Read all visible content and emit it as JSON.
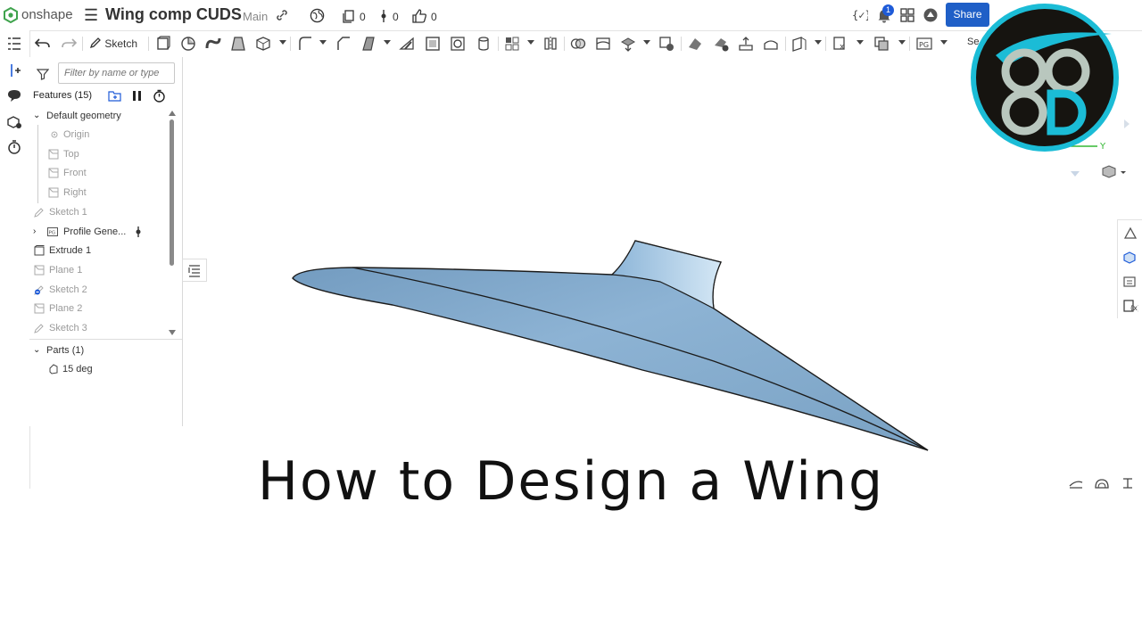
{
  "app": {
    "brand": "onshape",
    "document_title": "Wing comp CUDS",
    "branch": "Main",
    "counters": {
      "versions": "0",
      "branches": "0",
      "likes": "0"
    },
    "notification_count": "1",
    "share_label": "Share",
    "search_label_partial": "Se"
  },
  "toolbar": {
    "sketch_label": "Sketch"
  },
  "feature_panel": {
    "filter_placeholder": "Filter by name or type",
    "features_title": "Features (15)",
    "default_geometry": "Default geometry",
    "items": [
      {
        "label": "Origin"
      },
      {
        "label": "Top"
      },
      {
        "label": "Front"
      },
      {
        "label": "Right"
      },
      {
        "label": "Sketch 1"
      },
      {
        "label": "Profile Gene..."
      },
      {
        "label": "Extrude 1"
      },
      {
        "label": "Plane 1"
      },
      {
        "label": "Sketch 2"
      },
      {
        "label": "Plane 2"
      },
      {
        "label": "Sketch 3"
      }
    ],
    "parts_title": "Parts (1)",
    "parts": [
      {
        "label": "15 deg"
      }
    ]
  },
  "viewport": {
    "axis_label": "Y",
    "headline": "How to Design a Wing"
  },
  "overlay_logo": {
    "letters": "CCD"
  },
  "colors": {
    "share": "#1f5fc7",
    "wing_fill": "#7ea6c8",
    "logo_ring": "#1bbcd6",
    "logo_bg": "#161410"
  }
}
